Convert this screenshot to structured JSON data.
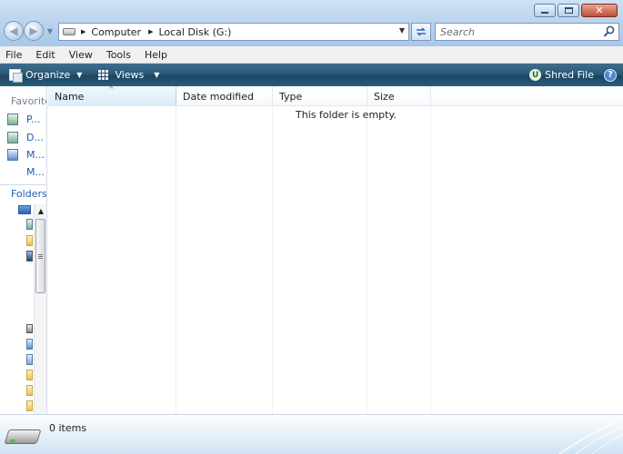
{
  "address_bar": {
    "breadcrumbs": [
      "Computer",
      "Local Disk (G:)"
    ]
  },
  "search": {
    "placeholder": "Search"
  },
  "menu": {
    "items": [
      "File",
      "Edit",
      "View",
      "Tools",
      "Help"
    ]
  },
  "toolbar": {
    "organize_label": "Organize",
    "views_label": "Views",
    "shred_label": "Shred File",
    "help_glyph": "?"
  },
  "nav_pane": {
    "favorites_heading": "Favorite l",
    "favorite_links": [
      "P...",
      "D...",
      "M...",
      "M..."
    ],
    "folders_heading": "Folders"
  },
  "columns": [
    "Name",
    "Date modified",
    "Type",
    "Size"
  ],
  "content": {
    "empty_message": "This folder is empty."
  },
  "status": {
    "item_count": "0 items"
  },
  "colors": {
    "command_bar": "#2b5978",
    "link_blue": "#1e5cb3",
    "title_bar": "#bcd4ee"
  },
  "icons": [
    "back-icon",
    "forward-icon",
    "drive-icon",
    "refresh-icon",
    "search-icon",
    "organize-icon",
    "views-icon",
    "shred-icon",
    "help-icon"
  ]
}
